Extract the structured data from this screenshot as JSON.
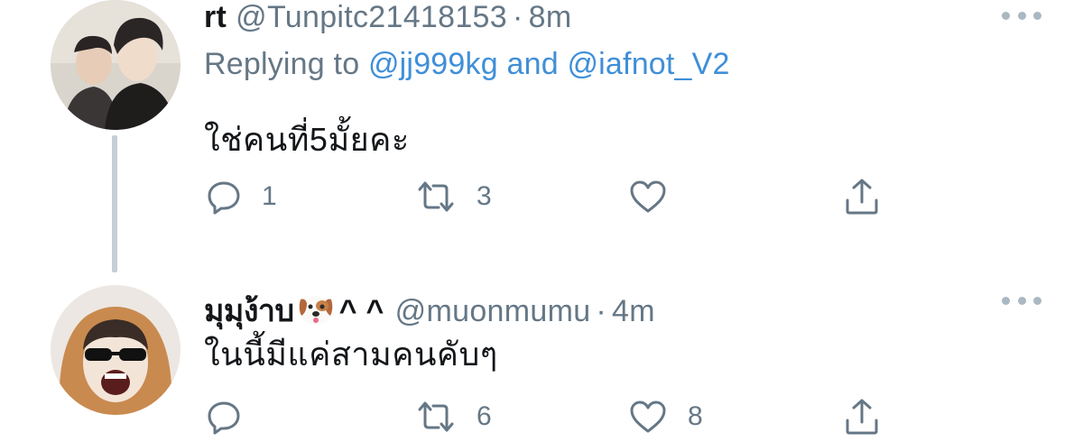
{
  "tweets": [
    {
      "display_name": "rt",
      "handle": "@Tunpitc21418153",
      "separator": "·",
      "time": "8m",
      "replying_prefix": "Replying to",
      "replying_to": [
        "@jj999kg",
        "@iafnot_V2"
      ],
      "replying_joiner": "and",
      "text": "ใช่คนที่5มั้ยคะ",
      "actions": {
        "reply": {
          "icon": "reply-icon",
          "count": "1"
        },
        "retweet": {
          "icon": "retweet-icon",
          "count": "3"
        },
        "like": {
          "icon": "heart-icon",
          "count": ""
        },
        "share": {
          "icon": "share-icon",
          "count": ""
        }
      },
      "avatar": "avatar-two-people"
    },
    {
      "display_name": "มุมุง้าบ",
      "name_emoji": "dog-face-emoji",
      "name_suffix": "^ ^",
      "handle": "@muonmumu",
      "separator": "·",
      "time": "4m",
      "text": "ในนี้มีแค่สามคนคับๆ",
      "actions": {
        "reply": {
          "icon": "reply-icon",
          "count": ""
        },
        "retweet": {
          "icon": "retweet-icon",
          "count": "6"
        },
        "like": {
          "icon": "heart-icon",
          "count": "8"
        },
        "share": {
          "icon": "share-icon",
          "count": ""
        }
      },
      "avatar": "avatar-sunglasses-hood"
    }
  ],
  "colors": {
    "text": "#14171a",
    "secondary": "#657786",
    "link": "#3f8fd8",
    "thread_line": "#c4cfd6",
    "more_dots": "#aab8c2"
  }
}
